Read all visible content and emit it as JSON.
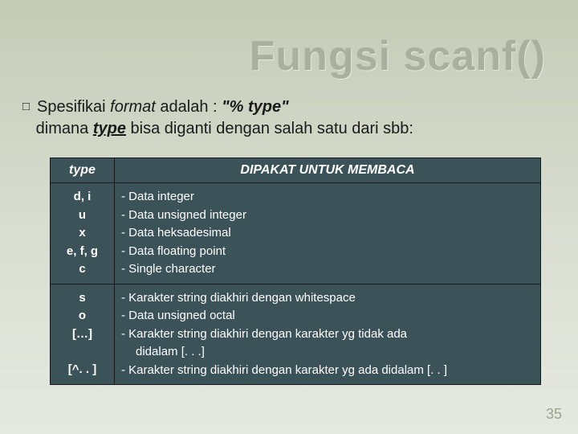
{
  "title": "Fungsi scanf()",
  "body": {
    "before_format": "Spesifikai ",
    "word_format": "format",
    "after_format": " adalah : ",
    "quote1": "\"% ",
    "type_word1": "type",
    "quote1b": "\"",
    "line2a": "dimana ",
    "type_word2": "type",
    "line2b": " bisa diganti dengan salah satu dari sbb:"
  },
  "table": {
    "header": {
      "col1": "type",
      "col2": "DIPAKAT UNTUK MEMBACA"
    },
    "row1": {
      "types": "d, i\nu\nx\ne, f, g\nc",
      "desc": "- Data integer\n- Data unsigned integer\n- Data heksadesimal\n- Data floating point\n- Single character"
    },
    "row2": {
      "t1": "s",
      "t2": "o",
      "t3": "[…]",
      "t4": "[^. . ]",
      "d1": "- Karakter string diakhiri dengan whitespace",
      "d2": "- Data unsigned octal",
      "d3a": "- Karakter string diakhiri dengan karakter yg tidak ada",
      "d3b": "didalam [. . .]",
      "d4": "- Karakter string diakhiri dengan karakter yg ada didalam [. . ]"
    }
  },
  "pagenum": "35"
}
